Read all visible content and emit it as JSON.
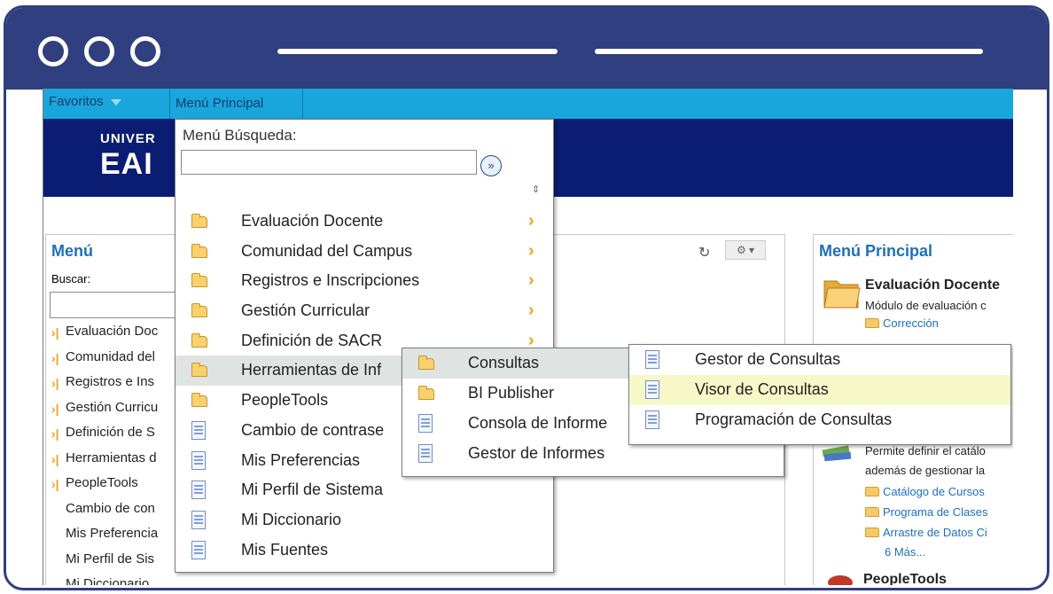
{
  "nav": {
    "favorites": "Favoritos",
    "main_menu": "Menú Principal"
  },
  "banner": {
    "logo_line1": "UNIVER",
    "logo_line2": "EAI"
  },
  "left_pagelet": {
    "title": "Menú",
    "search_label": "Buscar:",
    "items": [
      "Evaluación Doc",
      "Comunidad del",
      "Registros e Ins",
      "Gestión Curricu",
      "Definición de S",
      "Herramientas d",
      "PeopleTools",
      "Cambio de con",
      "Mis Preferencia",
      "Mi Perfil de Sis",
      "Mi Diccionario"
    ]
  },
  "right_pagelet": {
    "title": "Menú Principal",
    "eval_title": "Evaluación Docente",
    "eval_desc": "Módulo de evaluación c",
    "eval_link": "Corrección",
    "desc1": "Permite definir el catálo",
    "desc2": "además de gestionar la",
    "link1": "Catálogo de Cursos",
    "link2": "Programa de Clases",
    "link3": "Arrastre de Datos Ci",
    "more": "6 Más...",
    "peopletools": "PeopleTools"
  },
  "menu_main": {
    "search_label": "Menú Búsqueda:",
    "go": "»",
    "items": [
      "Evaluación Docente",
      "Comunidad del Campus",
      "Registros e Inscripciones",
      "Gestión Curricular",
      "Definición de SACR",
      "Herramientas de Inf",
      "PeopleTools",
      "Cambio de contrase",
      "Mis Preferencias",
      "Mi Perfil de Sistema",
      "Mi Diccionario",
      "Mis Fuentes"
    ]
  },
  "menu_sub": {
    "items": [
      "Consultas",
      "BI Publisher",
      "Consola de Informe",
      "Gestor de Informes"
    ]
  },
  "menu_sub2": {
    "items": [
      "Gestor de Consultas",
      "Visor de Consultas",
      "Programación de Consultas"
    ]
  }
}
